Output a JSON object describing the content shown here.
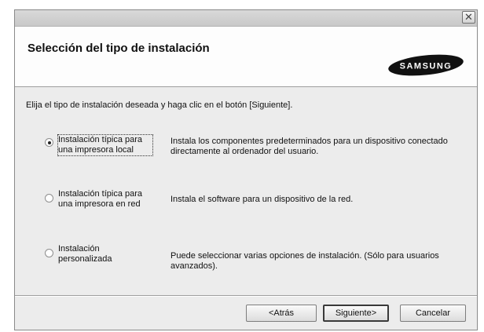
{
  "window": {
    "close_glyph": "✕"
  },
  "header": {
    "title": "Selección del tipo de instalación",
    "logo_text": "SAMSUNG"
  },
  "instruction": "Elija el tipo de instalación deseada y haga clic en el botón [Siguiente].",
  "options": [
    {
      "label": "Instalación típica para\nuna impresora local",
      "description": "Instala los componentes predeterminados para un dispositivo conectado\ndirectamente al ordenador del usuario.",
      "selected": true
    },
    {
      "label": "Instalación típica para\nuna impresora en red",
      "description": "Instala el software para un dispositivo de la red.",
      "selected": false
    },
    {
      "label": "Instalación\npersonalizada",
      "description": "Puede seleccionar varias opciones de instalación. (Sólo para usuarios\navanzados).",
      "selected": false
    }
  ],
  "buttons": {
    "back": "<Atrás",
    "next": "Siguiente>",
    "cancel": "Cancelar"
  }
}
